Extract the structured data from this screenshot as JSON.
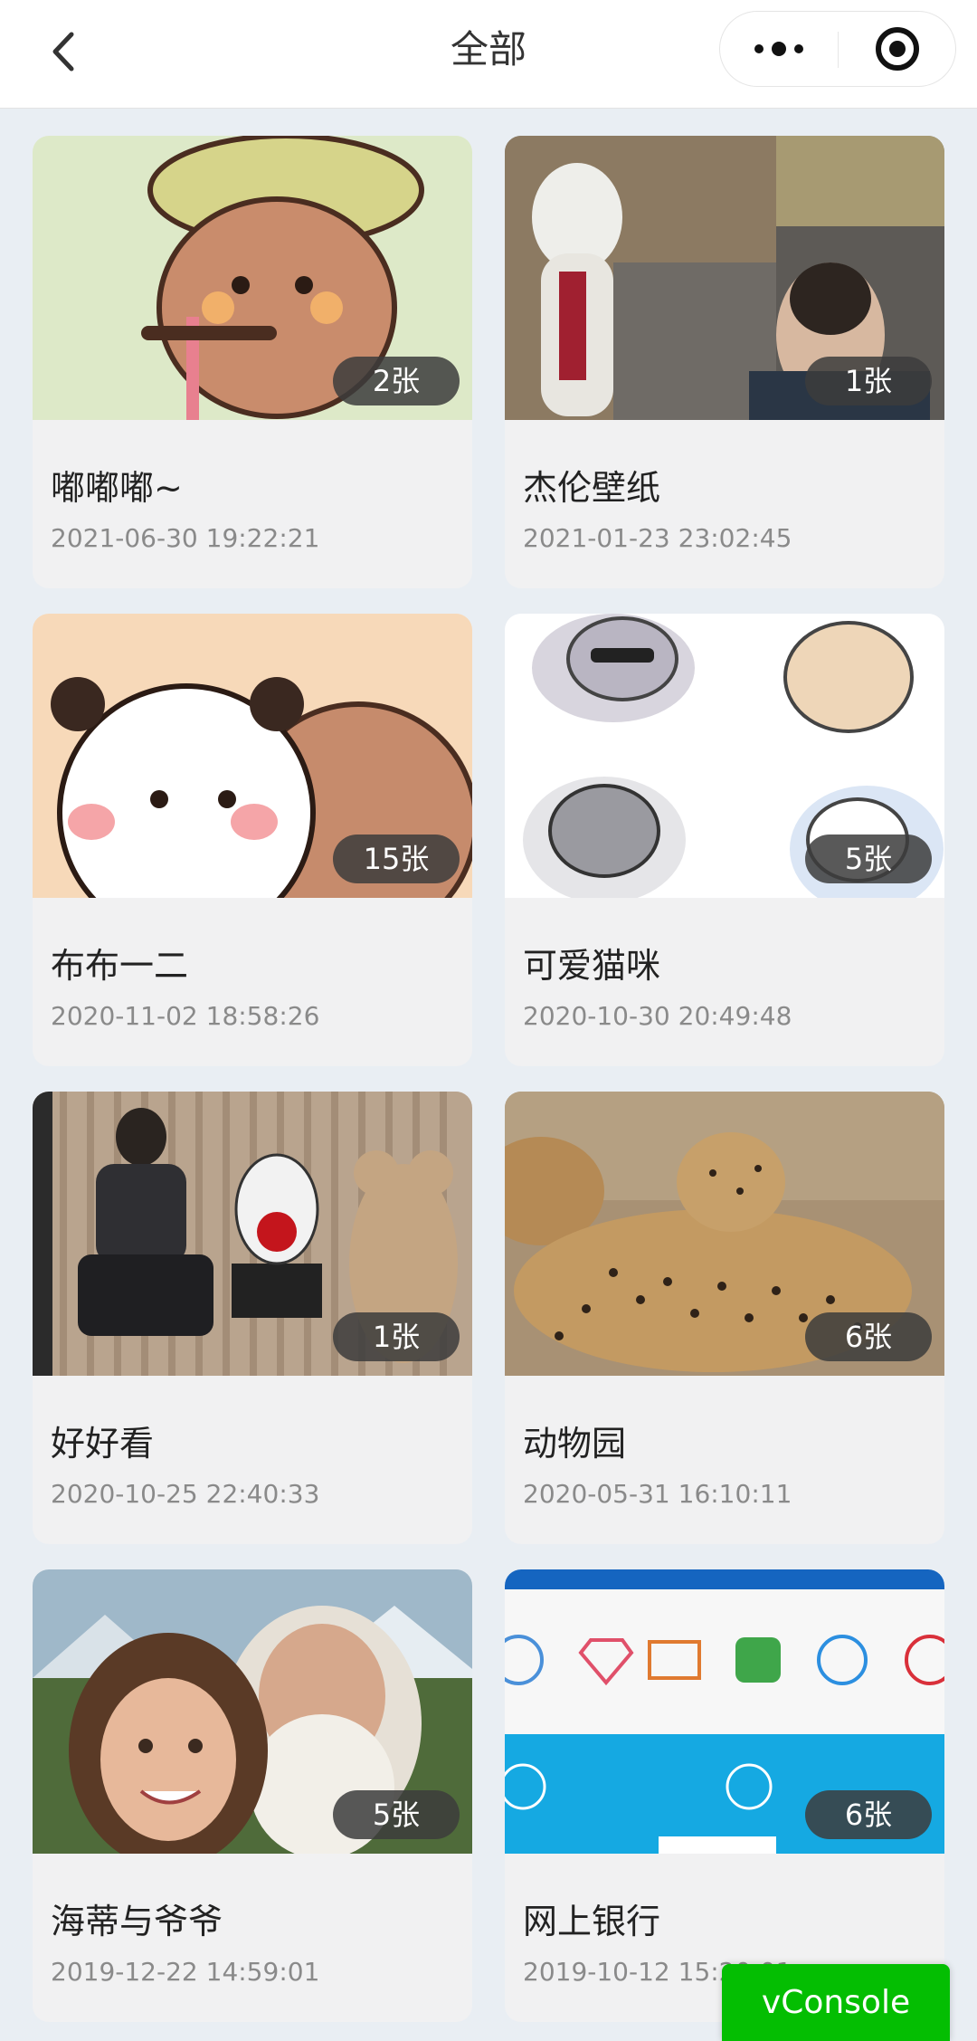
{
  "header": {
    "title": "全部",
    "back_icon": "chevron-left-icon",
    "more_icon": "more-dots-icon",
    "close_icon": "target-icon"
  },
  "albums": [
    {
      "title": "嘟嘟嘟~",
      "date": "2021-06-30 19:22:21",
      "count": "2张",
      "image": "cartoon bear on scooter"
    },
    {
      "title": "杰伦壁纸",
      "date": "2021-01-23 23:02:45",
      "count": "1张",
      "image": "husky dog and man in front of building"
    },
    {
      "title": "布布一二",
      "date": "2020-11-02 18:58:26",
      "count": "15张",
      "image": "cartoon panda and bear"
    },
    {
      "title": "可爱猫咪",
      "date": "2020-10-30 20:49:48",
      "count": "5张",
      "image": "cartoon cat stickers"
    },
    {
      "title": "好好看",
      "date": "2020-10-25 22:40:33",
      "count": "1张",
      "image": "man sitting with figurines"
    },
    {
      "title": "动物园",
      "date": "2020-05-31 16:10:11",
      "count": "6张",
      "image": "cheetahs on grass"
    },
    {
      "title": "海蒂与爷爷",
      "date": "2019-12-22 14:59:01",
      "count": "5张",
      "image": "girl and grandfather in mountains"
    },
    {
      "title": "网上银行",
      "date": "2019-10-12 15:20:01",
      "count": "6张",
      "image": "online banking webpage screenshot"
    }
  ],
  "vconsole": {
    "label": "vConsole"
  },
  "colors": {
    "background": "#e9eef3",
    "card": "#f1f1f2",
    "badge": "#3c3c3c",
    "vconsole": "#04be02"
  }
}
